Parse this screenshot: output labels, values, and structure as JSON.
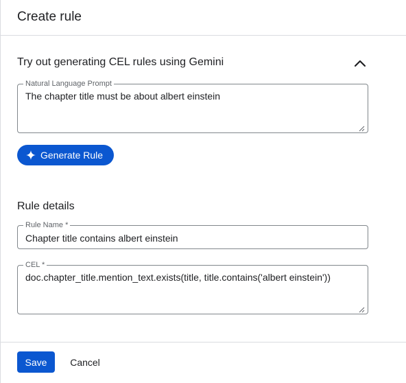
{
  "dialog": {
    "title": "Create rule"
  },
  "gemini": {
    "title": "Try out generating CEL rules using Gemini",
    "collapse_icon": "chevron-up-icon",
    "prompt": {
      "label": "Natural Language Prompt",
      "value": "The chapter title must be about albert einstein"
    },
    "generate_button": {
      "icon": "sparkle-icon",
      "label": "Generate Rule"
    }
  },
  "rule_details": {
    "title": "Rule details",
    "rule_name": {
      "label": "Rule Name *",
      "value": "Chapter title contains albert einstein"
    },
    "cel": {
      "label": "CEL *",
      "value": "doc.chapter_title.mention_text.exists(title, title.contains('albert einstein'))"
    }
  },
  "footer": {
    "save_label": "Save",
    "cancel_label": "Cancel"
  },
  "colors": {
    "primary": "#0b57d0",
    "border": "#80868b",
    "divider": "#dadce0",
    "text": "#202124",
    "label": "#5f6368"
  }
}
